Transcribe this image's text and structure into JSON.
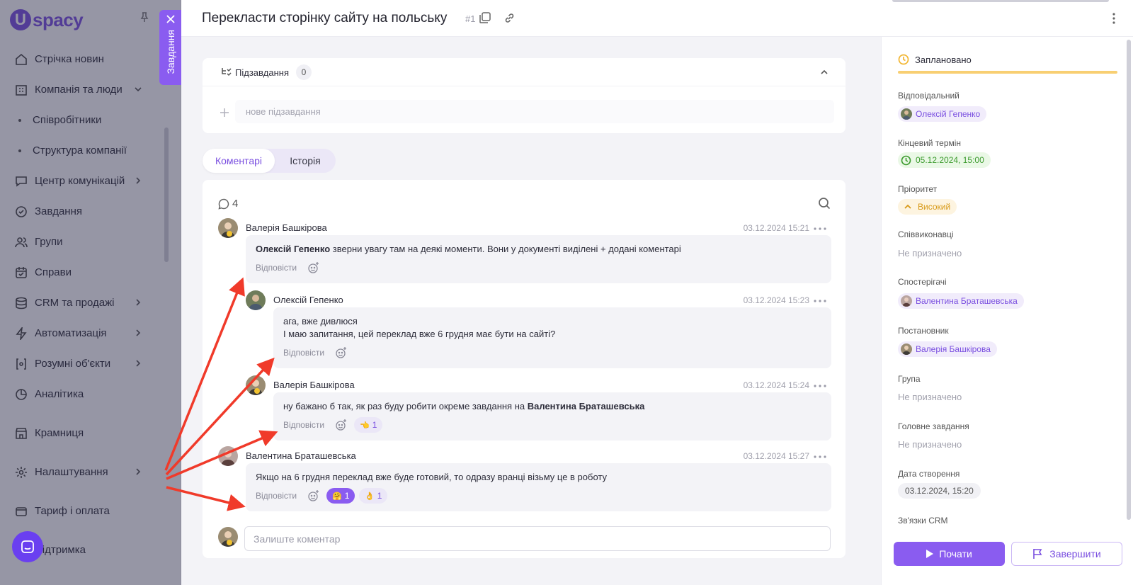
{
  "app": {
    "logo_letter": "U",
    "logo_text": "spacy"
  },
  "sidebar": {
    "items": [
      {
        "label": "Стрічка новин",
        "icon": "home-icon"
      },
      {
        "label": "Компанія та люди",
        "icon": "building-icon",
        "expanded": true
      },
      {
        "label": "Співробітники",
        "sub": true
      },
      {
        "label": "Структура компанії",
        "sub": true
      },
      {
        "label": "Центр комунікацій",
        "icon": "chat-icon"
      },
      {
        "label": "Завдання",
        "icon": "check-circle-icon"
      },
      {
        "label": "Групи",
        "icon": "users-icon"
      },
      {
        "label": "Справи",
        "icon": "calendar-icon"
      },
      {
        "label": "CRM та продажі",
        "icon": "database-icon"
      },
      {
        "label": "Автоматизація",
        "icon": "lightning-icon"
      },
      {
        "label": "Розумні об'єкти",
        "icon": "brackets-icon"
      },
      {
        "label": "Аналітика",
        "icon": "chart-icon"
      },
      {
        "label": "Крамниця",
        "icon": "store-icon"
      },
      {
        "label": "Налаштування",
        "icon": "gear-icon"
      },
      {
        "label": "Тариф і оплата",
        "icon": "wallet-icon"
      },
      {
        "label": "Підтримка",
        "icon": "support-icon"
      }
    ],
    "tasks_tab_label": "Завдання"
  },
  "header": {
    "title": "Перекласти сторінку сайту на польську",
    "task_number": "#1"
  },
  "subtasks": {
    "title": "Підзавдання",
    "count": "0",
    "input_placeholder": "нове підзавдання"
  },
  "tabs": {
    "comments": "Коментарі",
    "history": "Історія"
  },
  "comments": {
    "count": "4",
    "items": [
      {
        "author": "Валерія Башкірова",
        "date": "03.12.2024 15:21",
        "mention": "Олексій Гепенко",
        "text": " зверни увагу там на деякі моменти. Вони у документі виділені + додані коментарі",
        "reply_label": "Відповісти"
      },
      {
        "author": "Олексій Гепенко",
        "date": "03.12.2024 15:23",
        "line1": " ага, вже дивлюся",
        "line2": "І маю запитання, цей переклад вже 6 грудня має бути на сайті?",
        "reply_label": "Відповісти"
      },
      {
        "author": "Валерія Башкірова",
        "date": "03.12.2024 15:24",
        "text": "ну бажано б так, як раз буду робити окреме завдання на ",
        "mention": "Валентина Браташевська",
        "reply_label": "Відповісти",
        "reactions": [
          {
            "emoji": "👈",
            "count": "1"
          }
        ]
      },
      {
        "author": "Валентина Браташевська",
        "date": "03.12.2024 15:27",
        "text": "Якщо на 6 грудня переклад вже буде готовий, то одразу вранці візьму це в роботу",
        "reply_label": "Відповісти",
        "reactions": [
          {
            "emoji": "🤗",
            "count": "1",
            "active": true
          },
          {
            "emoji": "👌",
            "count": "1"
          }
        ]
      }
    ],
    "new_comment_placeholder": "Залиште коментар"
  },
  "details": {
    "status": "Заплановано",
    "responsible_label": "Відповідальний",
    "responsible": "Олексій Гепенко",
    "deadline_label": "Кінцевий термін",
    "deadline": "05.12.2024, 15:00",
    "priority_label": "Пріоритет",
    "priority": "Високий",
    "coexecutors_label": "Співвиконавці",
    "coexecutors": "Не призначено",
    "observers_label": "Спостерігачі",
    "observer": "Валентина Браташевська",
    "creator_label": "Постановник",
    "creator": "Валерія Башкірова",
    "group_label": "Група",
    "group": "Не призначено",
    "parent_label": "Головне завдання",
    "parent": "Не призначено",
    "created_label": "Дата створення",
    "created": "03.12.2024, 15:20",
    "crm_label": "Зв'язки CRM"
  },
  "actions": {
    "start": "Почати",
    "finish": "Завершити"
  },
  "colors": {
    "accent": "#8a5cf0",
    "status": "#f8cf72",
    "annotation_arrow": "#f03a2a"
  }
}
